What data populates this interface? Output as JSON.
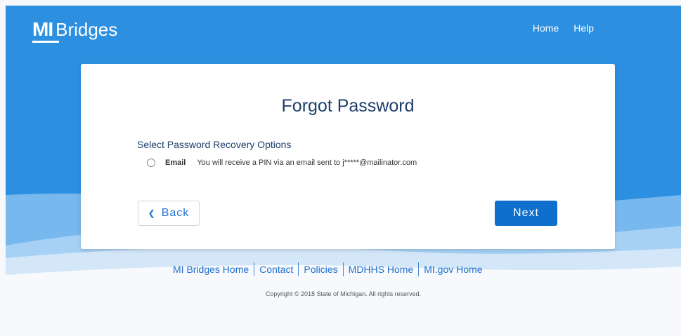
{
  "header": {
    "logo_mi": "MI",
    "logo_name": "Bridges",
    "nav": [
      "Home",
      "Help"
    ]
  },
  "card": {
    "title": "Forgot Password",
    "subheading": "Select Password Recovery Options",
    "option": {
      "label": "Email",
      "description": "You will receive a PIN via an email sent to j*****@mailinator.com",
      "selected": false
    },
    "back_label": "Back",
    "next_label": "Next"
  },
  "footer": {
    "links": [
      "MI Bridges Home",
      "Contact",
      "Policies",
      "MDHHS Home",
      "MI.gov Home"
    ],
    "copyright": "Copyright © 2018 State of Michigan. All rights reserved."
  },
  "colors": {
    "header_blue": "#2d8fe0",
    "primary_button": "#0f6fcc",
    "link": "#1f6fd0",
    "title": "#1e3e6b"
  }
}
